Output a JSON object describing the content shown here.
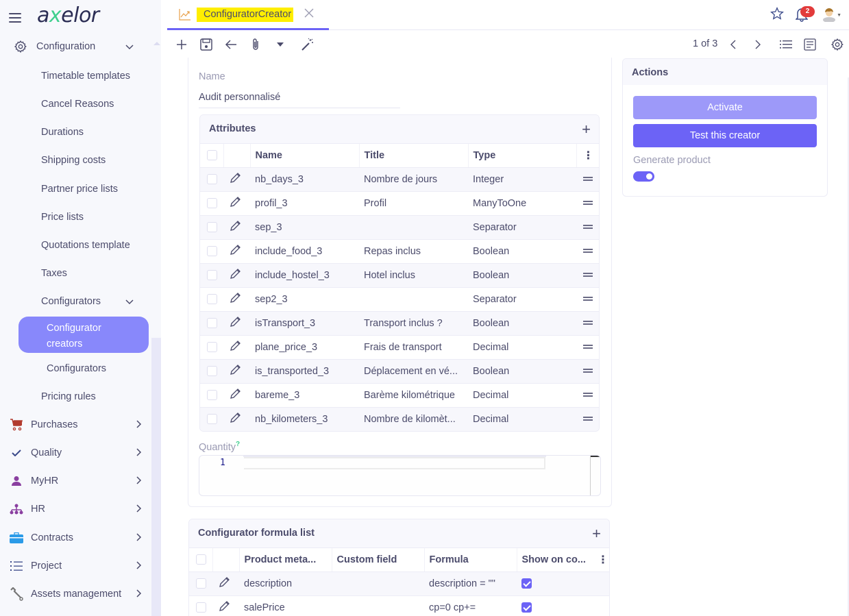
{
  "app": {
    "logo": {
      "pre": "a",
      "x": "x",
      "post": "elor"
    }
  },
  "sidebar": {
    "section": {
      "label": "Configuration",
      "icon": "gear-icon"
    },
    "items": [
      {
        "label": "Timetable templates"
      },
      {
        "label": "Cancel Reasons"
      },
      {
        "label": "Durations"
      },
      {
        "label": "Shipping costs"
      },
      {
        "label": "Partner price lists"
      },
      {
        "label": "Price lists"
      },
      {
        "label": "Quotations template"
      },
      {
        "label": "Taxes"
      }
    ],
    "configurators": {
      "label": "Configurators",
      "children": [
        {
          "label": "Configurator creators",
          "active": true
        },
        {
          "label": "Configurators"
        }
      ]
    },
    "pricing_rules": {
      "label": "Pricing rules"
    },
    "modules": [
      {
        "label": "Purchases",
        "icon": "cart-icon",
        "color": "#b23a2e"
      },
      {
        "label": "Quality",
        "icon": "check-icon",
        "color": "#3b4a8a"
      },
      {
        "label": "MyHR",
        "icon": "person-icon",
        "color": "#8a3fa0"
      },
      {
        "label": "HR",
        "icon": "org-chart-icon",
        "color": "#8a3fa0"
      },
      {
        "label": "Contracts",
        "icon": "briefcase-icon",
        "color": "#2b9be8"
      },
      {
        "label": "Project",
        "icon": "list-icon",
        "color": "#3b4a8a"
      },
      {
        "label": "Assets management",
        "icon": "wrench-icon",
        "color": "#666"
      }
    ]
  },
  "header": {
    "tab_title": "ConfiguratorCreator",
    "notification_count": "2"
  },
  "toolbar": {
    "pager": "1 of 3"
  },
  "form": {
    "name_label": "Name",
    "name_value": "Audit personnalisé",
    "attributes": {
      "title": "Attributes",
      "columns": [
        "Name",
        "Title",
        "Type"
      ],
      "rows": [
        {
          "name": "nb_days_3",
          "title": "Nombre de jours",
          "type": "Integer"
        },
        {
          "name": "profil_3",
          "title": "Profil",
          "type": "ManyToOne"
        },
        {
          "name": "sep_3",
          "title": "",
          "type": "Separator"
        },
        {
          "name": "include_food_3",
          "title": "Repas inclus",
          "type": "Boolean"
        },
        {
          "name": "include_hostel_3",
          "title": "Hotel inclus",
          "type": "Boolean"
        },
        {
          "name": "sep2_3",
          "title": "",
          "type": "Separator"
        },
        {
          "name": "isTransport_3",
          "title": "Transport inclus ?",
          "type": "Boolean"
        },
        {
          "name": "plane_price_3",
          "title": "Frais de transport",
          "type": "Decimal"
        },
        {
          "name": "is_transported_3",
          "title": "Déplacement en vé...",
          "type": "Boolean"
        },
        {
          "name": "bareme_3",
          "title": "Barème kilométrique",
          "type": "Decimal"
        },
        {
          "name": "nb_kilometers_3",
          "title": "Nombre de kilomèt...",
          "type": "Decimal"
        }
      ]
    },
    "quantity": {
      "label": "Quantity",
      "help": "?",
      "line_number": "1",
      "value": ""
    },
    "formulas": {
      "title": "Configurator formula list",
      "columns": [
        "Product meta...",
        "Custom field",
        "Formula",
        "Show on co..."
      ],
      "rows": [
        {
          "product_meta": "description",
          "custom_field": "",
          "formula": "description = \"\"",
          "show": true
        },
        {
          "product_meta": "salePrice",
          "custom_field": "",
          "formula": "cp=0 cp+=",
          "show": true
        }
      ]
    }
  },
  "actions": {
    "title": "Actions",
    "activate_label": "Activate",
    "test_label": "Test this creator",
    "generate_product_label": "Generate product",
    "generate_product": true
  },
  "colors": {
    "accent": "#6c63f6",
    "accent_light": "#9d99f9",
    "sidebar_active": "#8888fb",
    "tab_highlight": "#ffee00",
    "badge": "#e23b3b"
  }
}
